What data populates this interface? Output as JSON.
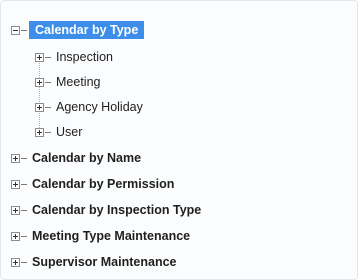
{
  "tree": {
    "root": {
      "label": "Calendar by Type",
      "expanded": true,
      "selected": true,
      "children": [
        {
          "label": "Inspection"
        },
        {
          "label": "Meeting"
        },
        {
          "label": "Agency Holiday"
        },
        {
          "label": "User"
        }
      ]
    },
    "siblings": [
      {
        "label": "Calendar by Name"
      },
      {
        "label": "Calendar by Permission"
      },
      {
        "label": "Calendar by Inspection Type"
      },
      {
        "label": "Meeting Type Maintenance"
      },
      {
        "label": "Supervisor Maintenance"
      }
    ]
  },
  "colors": {
    "selection_background": "#3d8ee8",
    "selection_text": "#ffffff",
    "text": "#1f1f1f"
  },
  "icons": {
    "expanded": "minus-box-icon",
    "collapsed": "plus-box-icon"
  }
}
